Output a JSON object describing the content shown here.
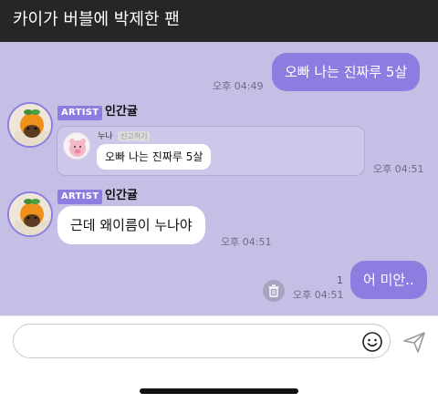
{
  "title_bar": {
    "title": "카이가 버블에 박제한 팬"
  },
  "messages": [
    {
      "from": "fan",
      "text": "오빠 나는 진짜루 5살",
      "time": "오후 04:49"
    },
    {
      "from": "artist",
      "badge": "ARTIST",
      "name": "인간귤",
      "quote": {
        "name": "누나",
        "tag": "신고하기",
        "text": "오빠 나는 진짜루 5살"
      },
      "time": "오후 04:51"
    },
    {
      "from": "artist",
      "badge": "ARTIST",
      "name": "인간귤",
      "text": "근데 왜이름이 누나야",
      "time": "오후 04:51"
    },
    {
      "from": "fan",
      "text": "어 미안..",
      "time": "오후 04:51",
      "unread": "1"
    }
  ],
  "input": {
    "placeholder": "",
    "value": ""
  },
  "colors": {
    "title_bar": "#262626",
    "chat_background": "#c5bfe6",
    "bubble_outgoing": "#8c7de0",
    "bubble_incoming": "#ffffff",
    "accent": "#8c7de0"
  },
  "icons": {
    "emoji": "smiley-icon",
    "send": "send-icon",
    "trash": "trash-icon"
  }
}
